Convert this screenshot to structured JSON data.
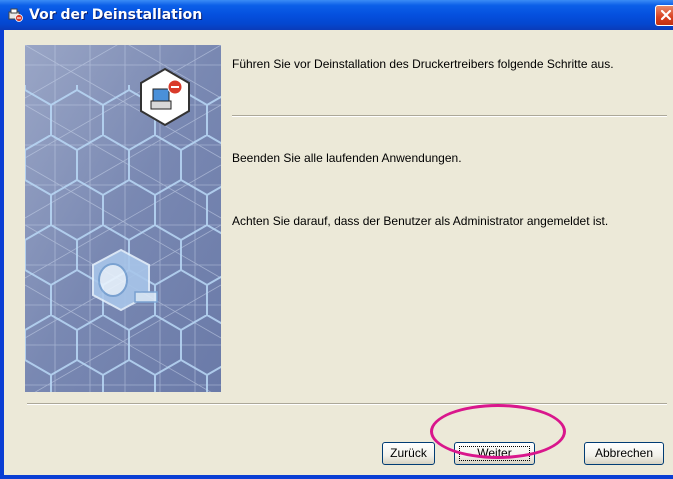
{
  "window": {
    "title": "Vor der Deinstallation"
  },
  "content": {
    "intro": "Führen Sie vor Deinstallation des Druckertreibers folgende Schritte aus.",
    "step1": "Beenden Sie alle laufenden Anwendungen.",
    "step2": "Achten Sie darauf, dass der Benutzer als Administrator angemeldet ist."
  },
  "buttons": {
    "back": "Zurück",
    "next": "Weiter",
    "cancel": "Abbrechen"
  },
  "colors": {
    "title_bar": "#0550de",
    "dialog_face": "#ece9d8",
    "highlight_ring": "#d9168c"
  },
  "icons": {
    "title": "uninstall-printer-icon",
    "close": "close-icon",
    "side_badge": "uninstall-badge-icon"
  }
}
